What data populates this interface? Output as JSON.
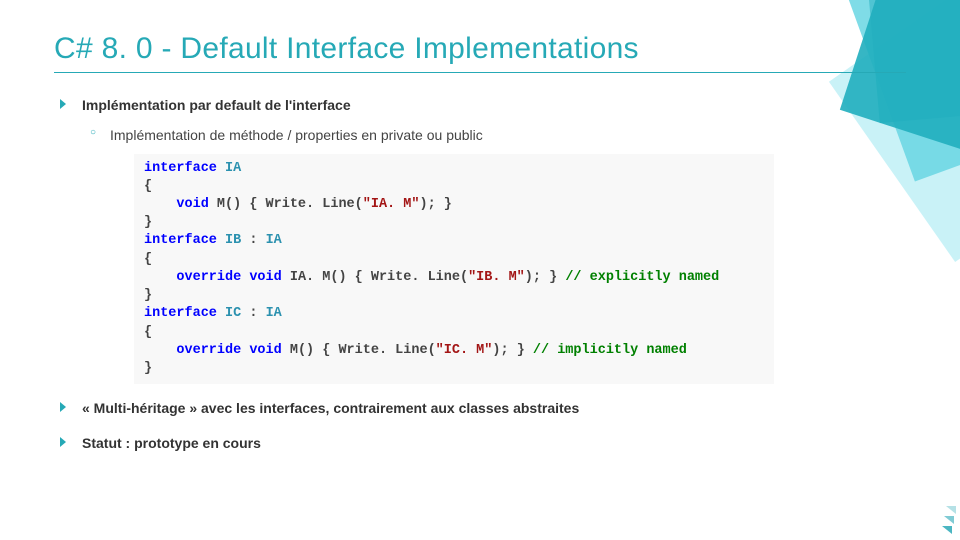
{
  "title": "C# 8. 0 - Default Interface Implementations",
  "bullets": {
    "b1": "Implémentation par default de l'interface",
    "b1_sub1": "Implémentation de méthode / properties en private ou public",
    "b2": "« Multi-héritage » avec les interfaces, contrairement aux classes abstraites",
    "b3": "Statut : prototype en cours"
  },
  "code": {
    "l1_kw_interface": "interface",
    "l1_tp": "IA",
    "l2_open": "{",
    "l3_kw_void": "void",
    "l3_name_open": "M() { Write. Line(",
    "l3_str": "\"IA. M\"",
    "l3_name_close": "); }",
    "l4_close": "}",
    "l5_kw_interface": "interface",
    "l5_tp_ib": "IB",
    "l5_colon": ":",
    "l5_tp_ia": "IA",
    "l6_open": "{",
    "l7_kw_override": "override",
    "l7_kw_void": "void",
    "l7_qual": "IA. M() { Write. Line(",
    "l7_str": "\"IB. M\"",
    "l7_closepart": "); }",
    "l7_cm": "// explicitly named",
    "l8_close": "}",
    "l9_kw_interface": "interface",
    "l9_tp_ic": "IC",
    "l9_colon": ":",
    "l9_tp_ia": "IA",
    "l10_open": "{",
    "l11_kw_override": "override",
    "l11_kw_void": "void",
    "l11_sig": "M() { Write. Line(",
    "l11_str": "\"IC. M\"",
    "l11_closepart": "); }",
    "l11_cm": "// implicitly named",
    "l12_close": "}"
  }
}
